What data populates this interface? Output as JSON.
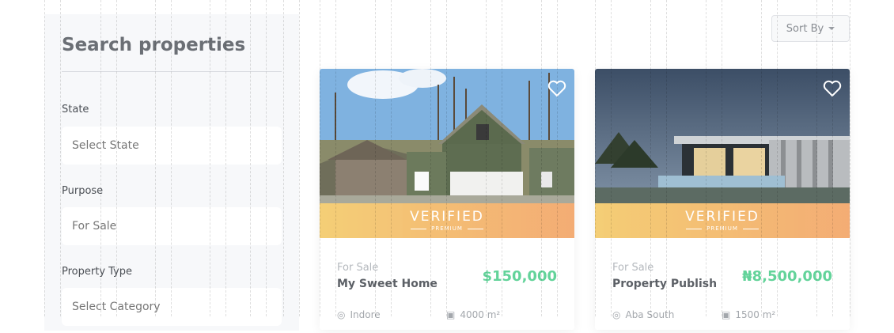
{
  "sidebar": {
    "title": "Search properties",
    "fields": [
      {
        "label": "State",
        "placeholder": "Select State"
      },
      {
        "label": "Purpose",
        "value": "For Sale"
      },
      {
        "label": "Property Type",
        "placeholder": "Select Category"
      }
    ]
  },
  "toolbar": {
    "sort_label": "Sort By"
  },
  "listings": [
    {
      "badge": "VERIFIED",
      "badge_sub": "PREMIUM",
      "purpose": "For Sale",
      "title": "My Sweet Home",
      "price": "$150,000",
      "location": "Indore",
      "area": "4000 m²"
    },
    {
      "badge": "VERIFIED",
      "badge_sub": "PREMIUM",
      "purpose": "For Sale",
      "title": "Property Publish",
      "price": "₦8,500,000",
      "location": "Aba South",
      "area": "1500 m²"
    }
  ],
  "colors": {
    "price": "#63d39a",
    "badge_start": "#f3c967",
    "badge_end": "#f2a365",
    "sidebar_bg": "#f7f8fa"
  }
}
